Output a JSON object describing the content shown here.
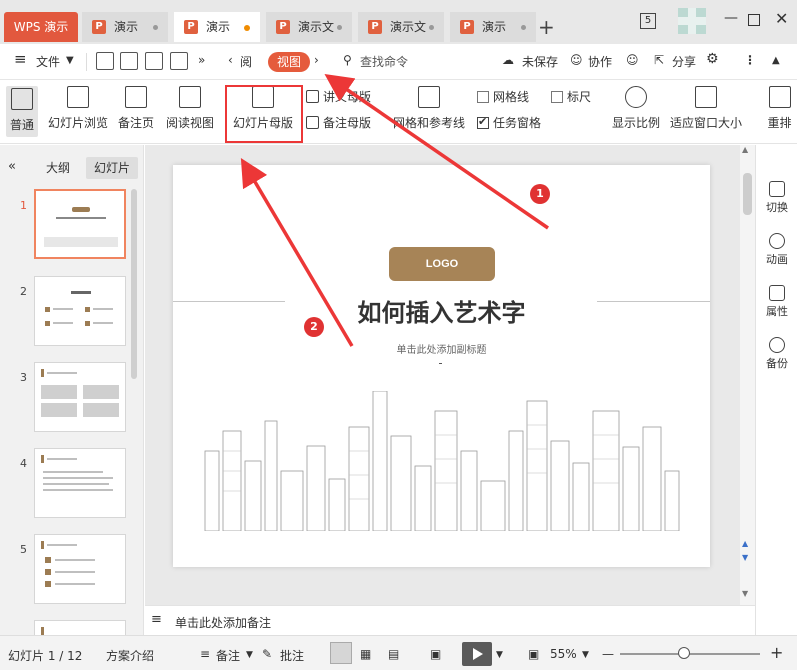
{
  "titlebar": {
    "app_name": "WPS 演示",
    "tabs": [
      {
        "label": "演示",
        "active": false
      },
      {
        "label": "演示",
        "active": true
      },
      {
        "label": "演示文",
        "active": false
      },
      {
        "label": "演示文",
        "active": false
      },
      {
        "label": "演示",
        "active": false
      }
    ],
    "tab_badge": "5"
  },
  "menubar": {
    "file": "文件",
    "prev_tab": "阅",
    "view": "视图",
    "search_placeholder": "查找命令",
    "unsaved": "未保存",
    "collab": "协作",
    "share": "分享"
  },
  "ribbon": {
    "normal": "普通",
    "slide_browse": "幻灯片浏览",
    "notes_page": "备注页",
    "reading_view": "阅读视图",
    "slide_master": "幻灯片母版",
    "handout_master": "讲义母版",
    "notes_master": "备注母版",
    "grid_guides": "网格和参考线",
    "gridlines": "网格线",
    "ruler": "标尺",
    "task_pane": "任务窗格",
    "zoom": "显示比例",
    "fit_window": "适应窗口大小",
    "rearrange": "重排"
  },
  "leftpanel": {
    "outline_tab": "大纲",
    "slides_tab": "幻灯片",
    "slides": [
      "1",
      "2",
      "3",
      "4",
      "5"
    ]
  },
  "slide": {
    "logo": "LOGO",
    "title": "如何插入艺术字",
    "subtitle": "单击此处添加副标题"
  },
  "notes": {
    "placeholder": "单击此处添加备注"
  },
  "rightpanel": {
    "items": [
      "切换",
      "动画",
      "属性",
      "备份"
    ]
  },
  "statusbar": {
    "slide_info": "幻灯片 1 / 12",
    "theme": "方案介绍",
    "notes": "备注",
    "comments": "批注",
    "zoom": "55%",
    "zoom_level": 0.55
  },
  "annotations": {
    "step1": "1",
    "step2": "2"
  },
  "colors": {
    "accent": "#e55b3c",
    "annotation": "#ec3737",
    "logo_bg": "#a78457"
  }
}
